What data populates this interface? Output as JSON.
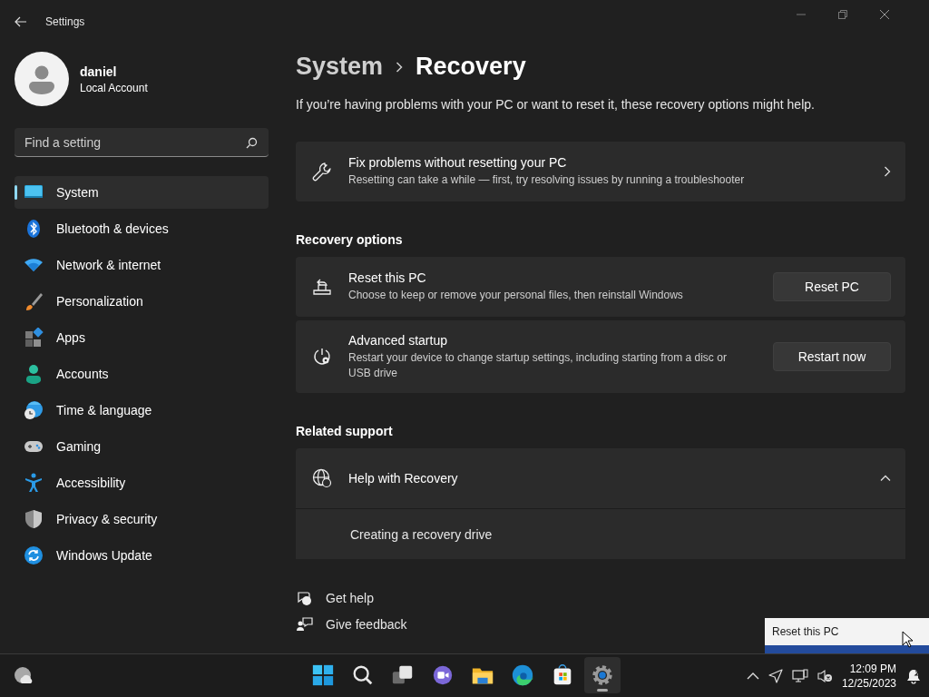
{
  "window": {
    "title": "Settings"
  },
  "user": {
    "name": "daniel",
    "account_type": "Local Account"
  },
  "search": {
    "placeholder": "Find a setting"
  },
  "nav": [
    {
      "label": "System",
      "selected": true
    },
    {
      "label": "Bluetooth & devices",
      "selected": false
    },
    {
      "label": "Network & internet",
      "selected": false
    },
    {
      "label": "Personalization",
      "selected": false
    },
    {
      "label": "Apps",
      "selected": false
    },
    {
      "label": "Accounts",
      "selected": false
    },
    {
      "label": "Time & language",
      "selected": false
    },
    {
      "label": "Gaming",
      "selected": false
    },
    {
      "label": "Accessibility",
      "selected": false
    },
    {
      "label": "Privacy & security",
      "selected": false
    },
    {
      "label": "Windows Update",
      "selected": false
    }
  ],
  "breadcrumb": [
    "System",
    "Recovery"
  ],
  "description": "If you’re having problems with your PC or want to reset it, these recovery options might help.",
  "fix_card": {
    "title": "Fix problems without resetting your PC",
    "subtitle": "Resetting can take a while — first, try resolving issues by running a troubleshooter"
  },
  "recovery_options": {
    "heading": "Recovery options",
    "items": [
      {
        "title": "Reset this PC",
        "subtitle": "Choose to keep or remove your personal files, then reinstall Windows",
        "button": "Reset PC"
      },
      {
        "title": "Advanced startup",
        "subtitle": "Restart your device to change startup settings, including starting from a disc or USB drive",
        "button": "Restart now"
      }
    ]
  },
  "related_support": {
    "heading": "Related support",
    "title": "Help with Recovery",
    "expanded": true,
    "links": [
      "Creating a recovery drive"
    ]
  },
  "footer_links": [
    "Get help",
    "Give feedback"
  ],
  "popup": {
    "text": "Reset this PC"
  },
  "taskbar": {
    "apps": [
      {
        "selected": false
      },
      {
        "selected": false
      },
      {
        "selected": false
      },
      {
        "selected": false
      },
      {
        "selected": false
      },
      {
        "selected": false
      },
      {
        "selected": false
      },
      {
        "selected": true
      }
    ],
    "time": "12:09 PM",
    "date": "12/25/2023"
  }
}
